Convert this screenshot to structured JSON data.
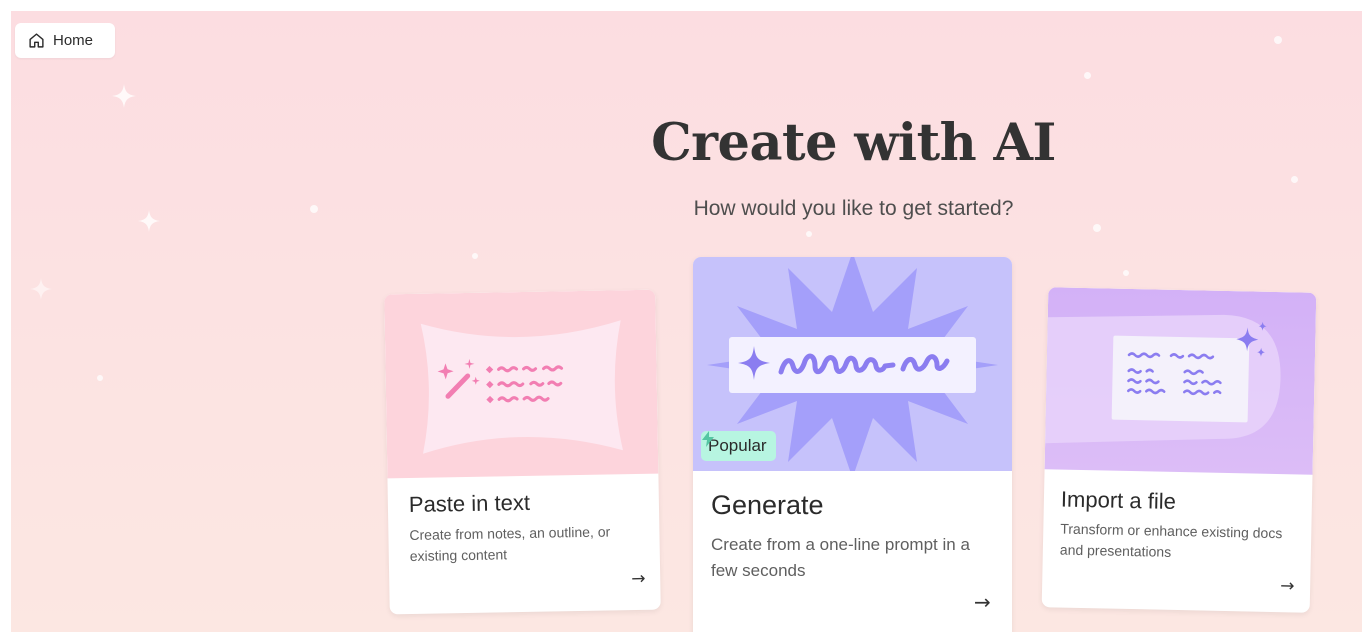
{
  "nav": {
    "home_label": "Home",
    "home_icon": "home-icon"
  },
  "hero": {
    "title": "Create with AI",
    "subtitle": "How would you like to get started?"
  },
  "cards": [
    {
      "title": "Paste in text",
      "description": "Create from notes, an outline, or existing content",
      "icon": "magic-wand-icon",
      "arrow": "→"
    },
    {
      "title": "Generate",
      "description": "Create from a one-line prompt in a few seconds",
      "badge": "Popular",
      "badge_icon": "lightning-icon",
      "icon": "sparkle-icon",
      "arrow": "→"
    },
    {
      "title": "Import a file",
      "description": "Transform or enhance existing docs and presentations",
      "icon": "sparkle-icon",
      "arrow": "→"
    }
  ],
  "colors": {
    "background_top": "#fcdde1",
    "background_bottom": "#fce7e2",
    "paste_illustration": "#fdd4dc",
    "generate_illustration": "#c6c2fb",
    "import_illustration": "#d3b1f7",
    "badge": "#b7f5e1",
    "pink_accent": "#f27eb2",
    "purple_accent": "#8b7df0"
  }
}
